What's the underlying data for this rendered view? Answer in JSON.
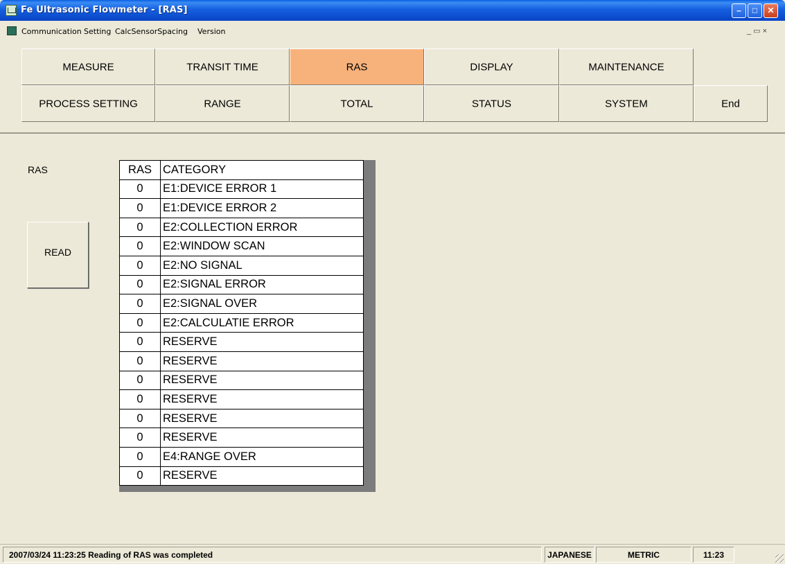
{
  "window": {
    "title": "Fe Ultrasonic Flowmeter - [RAS]",
    "minimize_glyph": "–",
    "maximize_glyph": "□",
    "close_glyph": "✕"
  },
  "menu": {
    "items": [
      "Communication",
      "Setting",
      "CalcSensorSpacing",
      "Version"
    ],
    "mdi_controls": "_ ▭ ×"
  },
  "tabs": {
    "row1": [
      "MEASURE",
      "TRANSIT TIME",
      "RAS",
      "DISPLAY",
      "MAINTENANCE"
    ],
    "row2": [
      "PROCESS SETTING",
      "RANGE",
      "TOTAL",
      "STATUS",
      "SYSTEM",
      "End"
    ],
    "active": "RAS",
    "active_color": "#f7b27b"
  },
  "ras_section": {
    "label": "RAS",
    "read_button": "READ"
  },
  "ras_table": {
    "headers": [
      "RAS",
      "CATEGORY"
    ],
    "rows": [
      [
        "0",
        "E1:DEVICE ERROR 1"
      ],
      [
        "0",
        "E1:DEVICE ERROR 2"
      ],
      [
        "0",
        "E2:COLLECTION ERROR"
      ],
      [
        "0",
        "E2:WINDOW SCAN"
      ],
      [
        "0",
        "E2:NO SIGNAL"
      ],
      [
        "0",
        "E2:SIGNAL ERROR"
      ],
      [
        "0",
        "E2:SIGNAL OVER"
      ],
      [
        "0",
        "E2:CALCULATIE ERROR"
      ],
      [
        "0",
        "RESERVE"
      ],
      [
        "0",
        "RESERVE"
      ],
      [
        "0",
        "RESERVE"
      ],
      [
        "0",
        "RESERVE"
      ],
      [
        "0",
        "RESERVE"
      ],
      [
        "0",
        "RESERVE"
      ],
      [
        "0",
        "E4:RANGE OVER"
      ],
      [
        "0",
        "RESERVE"
      ]
    ]
  },
  "statusbar": {
    "message": "2007/03/24 11:23:25 Reading of RAS was completed",
    "language": "JAPANESE",
    "units": "METRIC",
    "time": "11:23"
  }
}
